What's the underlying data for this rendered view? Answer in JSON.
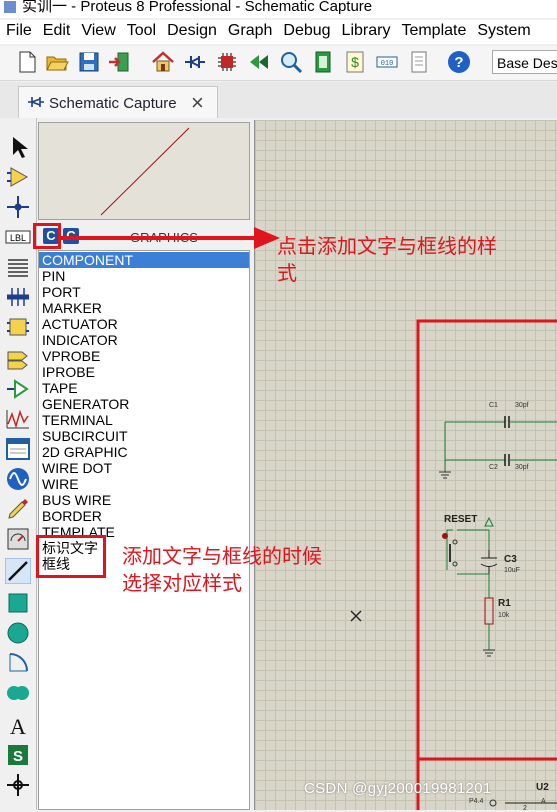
{
  "window": {
    "title": "实训一 - Proteus 8 Professional - Schematic Capture"
  },
  "menu": [
    "File",
    "Edit",
    "View",
    "Tool",
    "Design",
    "Graph",
    "Debug",
    "Library",
    "Template",
    "System"
  ],
  "toolbar": {
    "buttons": [
      "new-file-icon",
      "open-folder-icon",
      "save-icon",
      "import-icon",
      "home-icon",
      "schematic-icon",
      "pcb-icon",
      "3d-icon",
      "gerber-icon",
      "bom-icon",
      "vsm-icon",
      "notes-icon",
      "help-icon"
    ],
    "combo_value": "Base Des"
  },
  "tab": {
    "label": "Schematic Capture"
  },
  "selector": {
    "btn_c1": "C",
    "btn_c2": "C",
    "title": "GRAPHICS",
    "items": [
      "COMPONENT",
      "PIN",
      "PORT",
      "MARKER",
      "ACTUATOR",
      "INDICATOR",
      "VPROBE",
      "IPROBE",
      "TAPE",
      "GENERATOR",
      "TERMINAL",
      "SUBCIRCUIT",
      "2D GRAPHIC",
      "WIRE DOT",
      "WIRE",
      "BUS WIRE",
      "BORDER",
      "TEMPLATE",
      "标识文字",
      "框线"
    ],
    "selected_index": 0
  },
  "annotations": {
    "top_line1": "点击添加文字与框线的样",
    "top_line2": "式",
    "mid_line1": "添加文字与框线的时候",
    "mid_line2": "选择对应样式"
  },
  "schematic": {
    "c1": "C1",
    "c1_val": "30pf",
    "c2": "C2",
    "c2_val": "30pf",
    "reset": "RESET",
    "c3": "C3",
    "c3_val": "10uF",
    "r1": "R1",
    "r1_val": "10k",
    "u2": "U2",
    "p44": "P4.4",
    "pin2": "2",
    "pinA": "A"
  },
  "watermark": "CSDN @gyj200019981201"
}
